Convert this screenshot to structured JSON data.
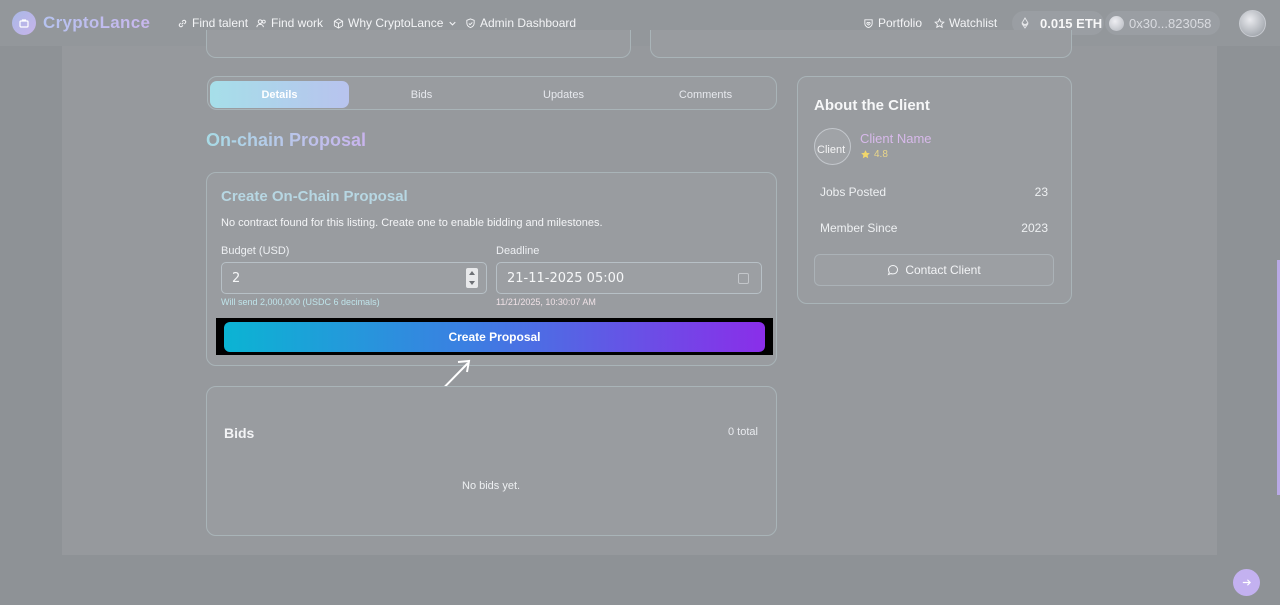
{
  "brand": {
    "name": "CryptoLance"
  },
  "nav": {
    "find_talent": "Find talent",
    "find_work": "Find work",
    "why": "Why CryptoLance",
    "admin": "Admin Dashboard",
    "portfolio": "Portfolio",
    "watchlist": "Watchlist"
  },
  "wallet": {
    "balance": "0.015 ETH",
    "address": "0x30...823058"
  },
  "tabs": [
    "Details",
    "Bids",
    "Updates",
    "Comments"
  ],
  "active_tab": "Details",
  "section_title": "On-chain Proposal",
  "proposal": {
    "title": "Create On-Chain Proposal",
    "description": "No contract found for this listing. Create one to enable bidding and milestones.",
    "budget_label": "Budget (USD)",
    "budget_value": "2",
    "budget_hint": "Will send 2,000,000 (USDC 6 decimals)",
    "deadline_label": "Deadline",
    "deadline_value": "21-11-2025 05:00",
    "deadline_hint": "11/21/2025, 10:30:07 AM",
    "create_button": "Create Proposal"
  },
  "bids": {
    "title": "Bids",
    "total": "0 total",
    "empty": "No bids yet."
  },
  "client": {
    "heading": "About the Client",
    "avatar_alt": "Client",
    "name": "Client Name",
    "rating": "4.8",
    "jobs_label": "Jobs Posted",
    "jobs_value": "23",
    "member_label": "Member Since",
    "member_value": "2023",
    "contact_button": "Contact Client"
  },
  "colors": {
    "button_gradient_start": "#0bb4d3",
    "button_gradient_end": "#8a2ee9",
    "accent_title": "#b7d7e3",
    "client_name": "#d7b9ea"
  },
  "icons": {
    "logo": "briefcase-icon",
    "find_talent": "link-icon",
    "find_work": "users-icon",
    "why": "cube-icon",
    "admin": "shield-icon",
    "portfolio": "heart-shield-icon",
    "watchlist": "star-icon",
    "network": "ethereum-icon",
    "contact": "chat-bubble-icon",
    "fab": "arrow-right-icon"
  }
}
